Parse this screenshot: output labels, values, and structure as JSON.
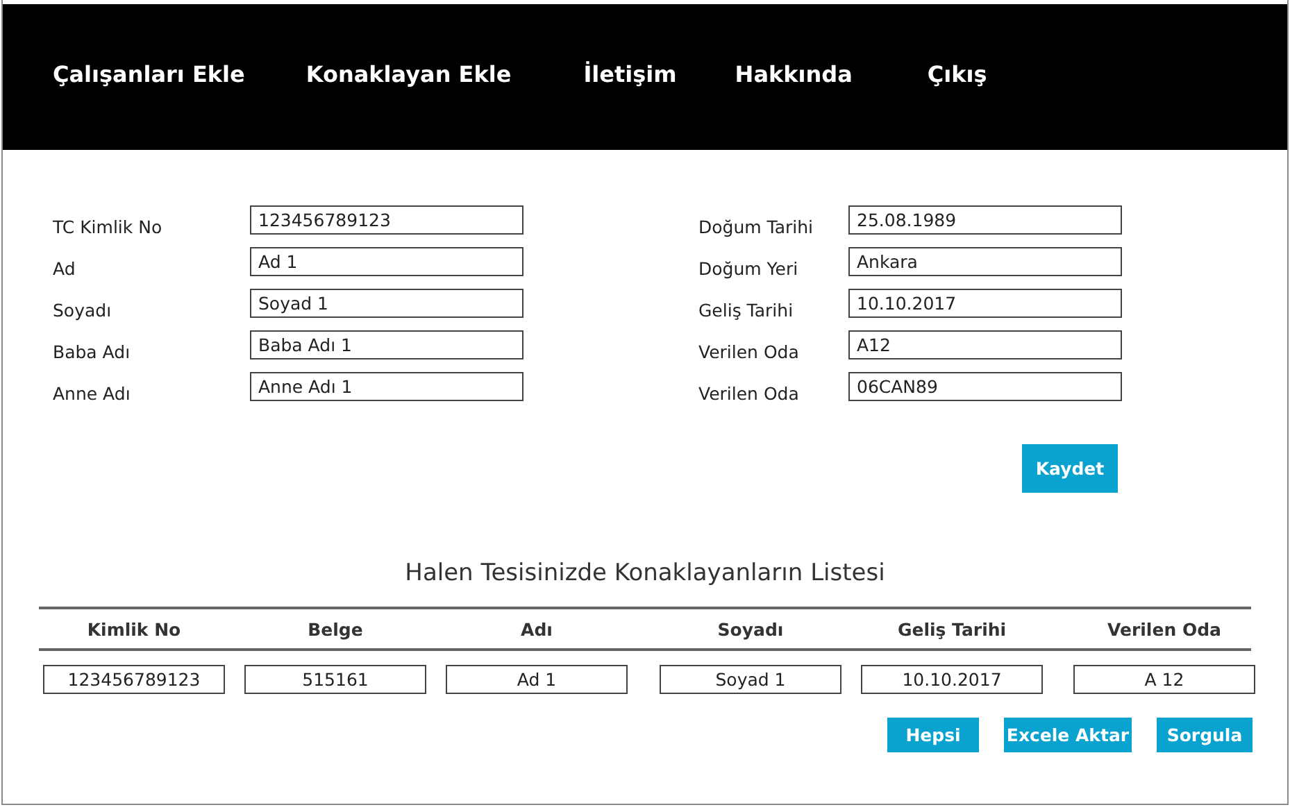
{
  "nav": [
    "Çalışanları Ekle",
    "Konaklayan Ekle",
    "İletişim",
    "Hakkında",
    "Çıkış"
  ],
  "form": {
    "left": [
      {
        "label": "TC Kimlik No",
        "value": "123456789123"
      },
      {
        "label": "Ad",
        "value": "Ad 1"
      },
      {
        "label": "Soyadı",
        "value": "Soyad 1"
      },
      {
        "label": "Baba Adı",
        "value": "Baba Adı 1"
      },
      {
        "label": "Anne Adı",
        "value": "Anne Adı 1"
      }
    ],
    "right": [
      {
        "label": "Doğum Tarihi",
        "value": "25.08.1989"
      },
      {
        "label": "Doğum Yeri",
        "value": "Ankara"
      },
      {
        "label": "Geliş Tarihi",
        "value": "10.10.2017"
      },
      {
        "label": "Verilen Oda",
        "value": "A12"
      },
      {
        "label": "Verilen Oda",
        "value": "06CAN89"
      }
    ],
    "save_button": "Kaydet"
  },
  "table": {
    "title": "Halen Tesisinizde Konaklayanların Listesi",
    "columns": [
      "Kimlik No",
      "Belge",
      "Adı",
      "Soyadı",
      "Geliş Tarihi",
      "Verilen Oda"
    ],
    "rows": [
      [
        "123456789123",
        "515161",
        "Ad 1",
        "Soyad 1",
        "10.10.2017",
        "A 12"
      ]
    ],
    "buttons": [
      "Hepsi",
      "Excele Aktar",
      "Sorgula"
    ]
  }
}
